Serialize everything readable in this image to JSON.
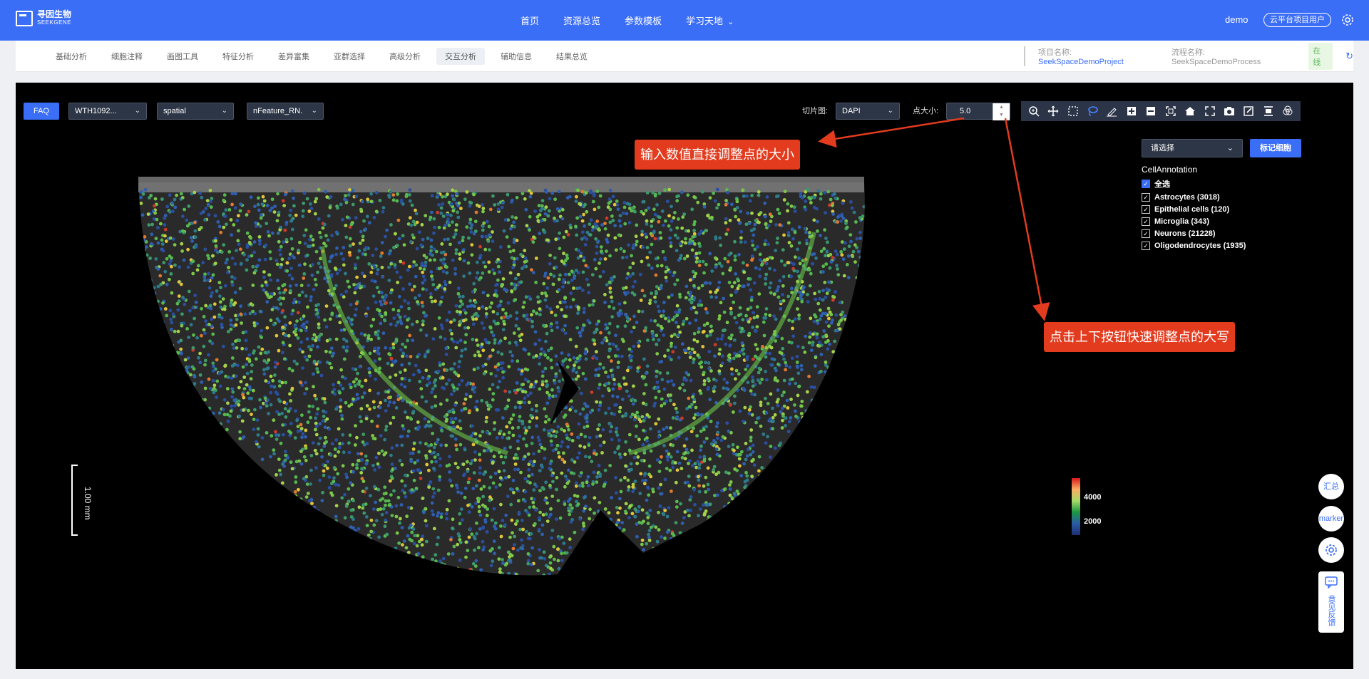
{
  "topnav": {
    "logo_cn": "寻因生物",
    "logo_en": "SEEKGENE",
    "items": [
      "首页",
      "资源总览",
      "参数模板",
      "学习天地"
    ],
    "user_name": "demo",
    "user_role": "云平台项目用户"
  },
  "subnav": {
    "tabs": [
      "基础分析",
      "细胞注释",
      "画图工具",
      "特征分析",
      "差异富集",
      "亚群选择",
      "高级分析",
      "交互分析",
      "辅助信息",
      "结果总览"
    ],
    "active_tab": "交互分析",
    "project_label": "项目名称:",
    "project_name": "SeekSpaceDemoProject",
    "process_label": "流程名称:",
    "process_name": "SeekSpaceDemoProcess",
    "status": "在线"
  },
  "controls": {
    "faq": "FAQ",
    "sample": "WTH1092...",
    "embedding": "spatial",
    "feature": "nFeature_RN.",
    "slice_label": "切片图:",
    "slice_value": "DAPI",
    "point_label": "点大小:",
    "point_value": "5.0"
  },
  "callouts": {
    "input": "输入数值直接调整点的大小",
    "spin": "点击上下按钮快速调整点的大写"
  },
  "legend": {
    "select_placeholder": "请选择",
    "mark_button": "标记细胞",
    "title": "CellAnnotation",
    "items": [
      {
        "label": "全选"
      },
      {
        "label": "Astrocytes (3018)"
      },
      {
        "label": "Epithelial cells (120)"
      },
      {
        "label": "Microglia (343)"
      },
      {
        "label": "Neurons (21228)"
      },
      {
        "label": "Oligodendrocytes (1935)"
      }
    ]
  },
  "scalebar": {
    "label": "1.00 mm"
  },
  "colorbar": {
    "ticks": [
      "4000",
      "2000"
    ]
  },
  "side": {
    "summary": "汇总",
    "marker": "marker",
    "feedback": "意见反馈"
  },
  "colors": {
    "primary": "#3b6ef6",
    "callout": "#e23b1e"
  }
}
